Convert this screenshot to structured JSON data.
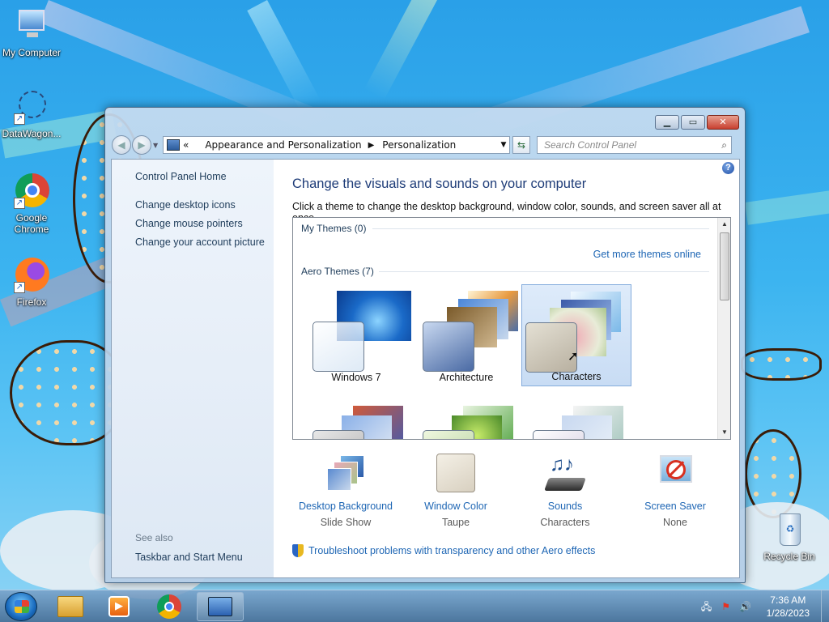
{
  "desktop": {
    "icons": [
      {
        "label": "My Computer"
      },
      {
        "label": "DataWagon..."
      },
      {
        "label": "Google Chrome"
      },
      {
        "label": "Firefox"
      },
      {
        "label": "Recycle Bin"
      }
    ]
  },
  "window": {
    "address": {
      "overflow": "«",
      "crumbs": [
        "Appearance and Personalization",
        "Personalization"
      ]
    },
    "search_placeholder": "Search Control Panel",
    "left": {
      "home": "Control Panel Home",
      "links": [
        "Change desktop icons",
        "Change mouse pointers",
        "Change your account picture"
      ],
      "see_also_heading": "See also",
      "see_also_links": [
        "Taskbar and Start Menu"
      ]
    },
    "main": {
      "title": "Change the visuals and sounds on your computer",
      "description": "Click a theme to change the desktop background, window color, sounds, and screen saver all at once.",
      "groups": {
        "my_themes": "My Themes (0)",
        "get_more": "Get more themes online",
        "aero_themes": "Aero Themes (7)"
      },
      "themes": [
        {
          "name": "Windows 7",
          "selected": false
        },
        {
          "name": "Architecture",
          "selected": false
        },
        {
          "name": "Characters",
          "selected": true
        }
      ],
      "settings": [
        {
          "name": "Desktop Background",
          "value": "Slide Show"
        },
        {
          "name": "Window Color",
          "value": "Taupe"
        },
        {
          "name": "Sounds",
          "value": "Characters"
        },
        {
          "name": "Screen Saver",
          "value": "None"
        }
      ],
      "troubleshoot": "Troubleshoot problems with transparency and other Aero effects"
    }
  },
  "taskbar": {
    "clock": {
      "time": "7:36 AM",
      "date": "1/28/2023"
    }
  },
  "colors": {
    "link": "#1e66b4",
    "title": "#1e3c78",
    "selected_bg": "#c8dcf4"
  }
}
